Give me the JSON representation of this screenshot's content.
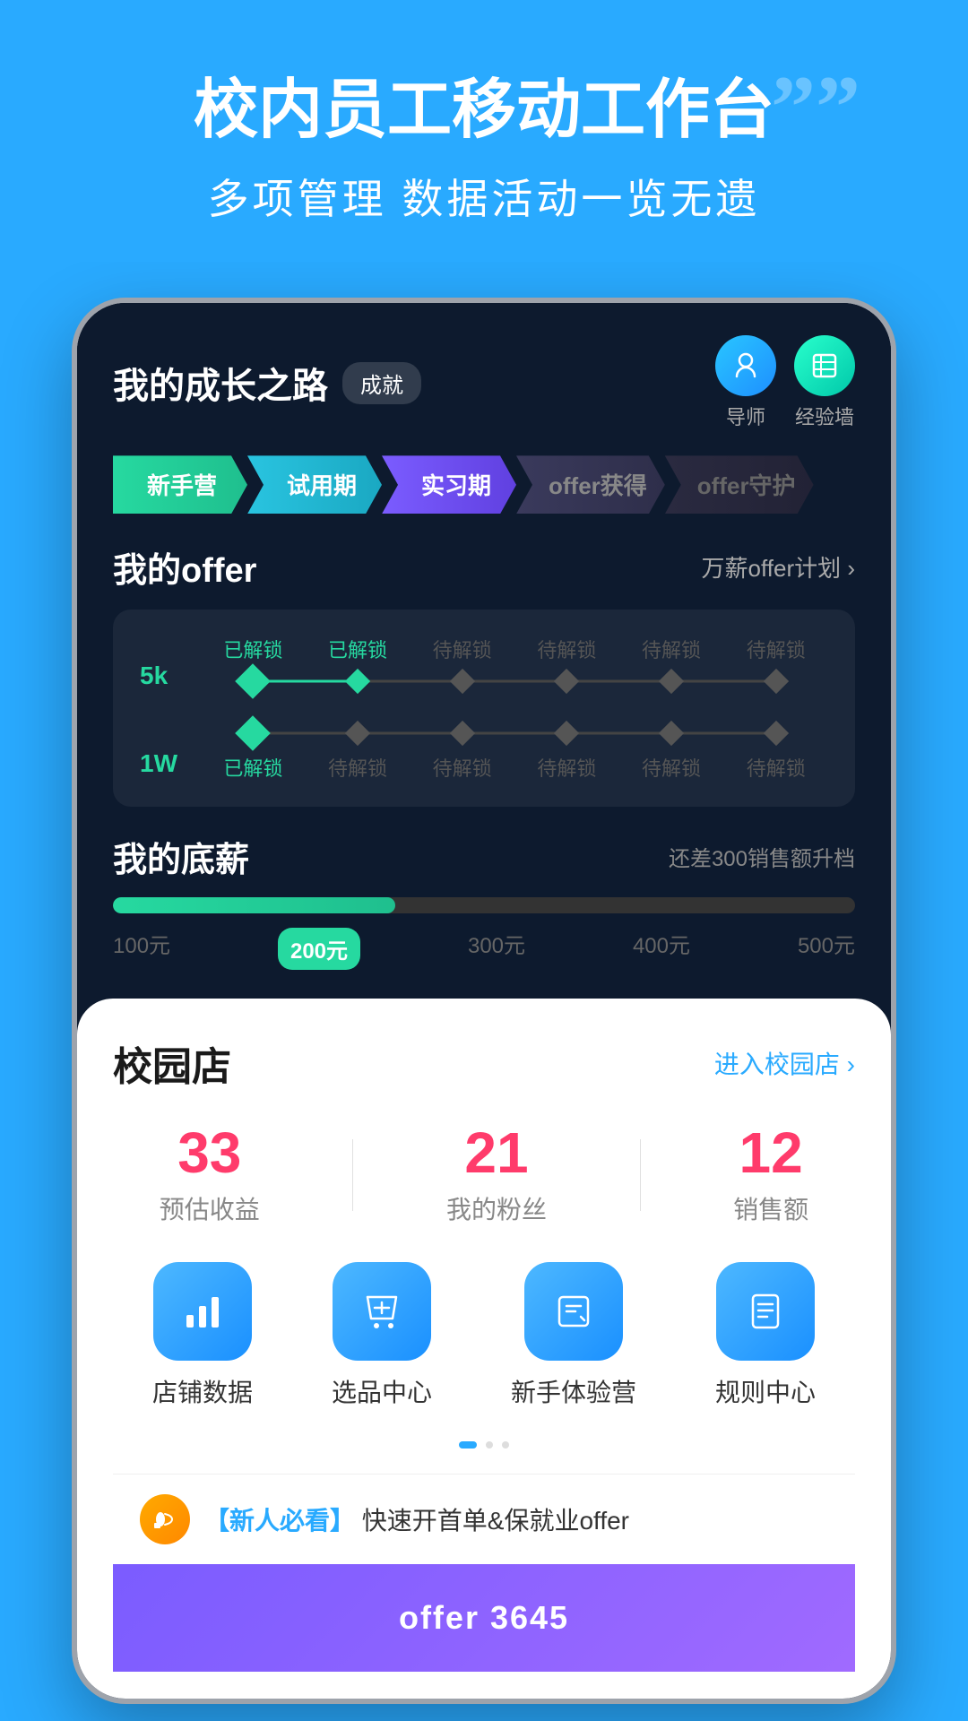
{
  "hero": {
    "title": "校内员工移动工作台",
    "subtitle": "多项管理  数据活动一览无遗",
    "quote_mark": "””"
  },
  "phone": {
    "growth": {
      "title": "我的成长之路",
      "badge": "成就",
      "tutor_label": "导师",
      "wall_label": "经验墙",
      "steps": [
        {
          "label": "新手营",
          "type": "xinshout"
        },
        {
          "label": "试用期",
          "type": "shiyong"
        },
        {
          "label": "实习期",
          "type": "shixi"
        },
        {
          "label": "offer获得",
          "type": "offer1"
        },
        {
          "label": "offer守护",
          "type": "offer2"
        }
      ],
      "offer_section": {
        "title": "我的offer",
        "link_text": "万薪offer计划 ›",
        "level_5k": "5k",
        "level_1w": "1W",
        "track_5k": {
          "nodes": [
            {
              "label": "已解锁",
              "status": "unlocked"
            },
            {
              "label": "已解锁",
              "status": "unlocked"
            },
            {
              "label": "待解锁",
              "status": "locked"
            },
            {
              "label": "待解锁",
              "status": "locked"
            },
            {
              "label": "待解锁",
              "status": "locked"
            },
            {
              "label": "待解锁",
              "status": "locked"
            }
          ]
        },
        "track_1w": {
          "nodes": [
            {
              "label": "已解锁",
              "status": "unlocked"
            },
            {
              "label": "待解锁",
              "status": "locked"
            },
            {
              "label": "待解锁",
              "status": "locked"
            },
            {
              "label": "待解锁",
              "status": "locked"
            },
            {
              "label": "待解锁",
              "status": "locked"
            },
            {
              "label": "待解锁",
              "status": "locked"
            }
          ]
        }
      },
      "salary_section": {
        "title": "我的底薪",
        "hint": "还差300销售额升档",
        "current": "200元",
        "labels": [
          "100元",
          "200元",
          "300元",
          "400元",
          "500元"
        ],
        "progress_percent": 38
      }
    },
    "campus": {
      "title": "校园店",
      "link_text": "进入校园店 ›",
      "stats": [
        {
          "number": "33",
          "label": "预估收益"
        },
        {
          "number": "21",
          "label": "我的粉丝"
        },
        {
          "number": "12",
          "label": "销售额"
        }
      ],
      "features": [
        {
          "icon": "📊",
          "label": "店铺数据"
        },
        {
          "icon": "🛍",
          "label": "选品中心"
        },
        {
          "icon": "📋",
          "label": "新手体验营"
        },
        {
          "icon": "📄",
          "label": "规则中心"
        }
      ],
      "notice": {
        "text_prefix": "【新人必看】",
        "text_main": "快速开首单&保就业offer"
      }
    },
    "offer_number": "offer 3645"
  }
}
